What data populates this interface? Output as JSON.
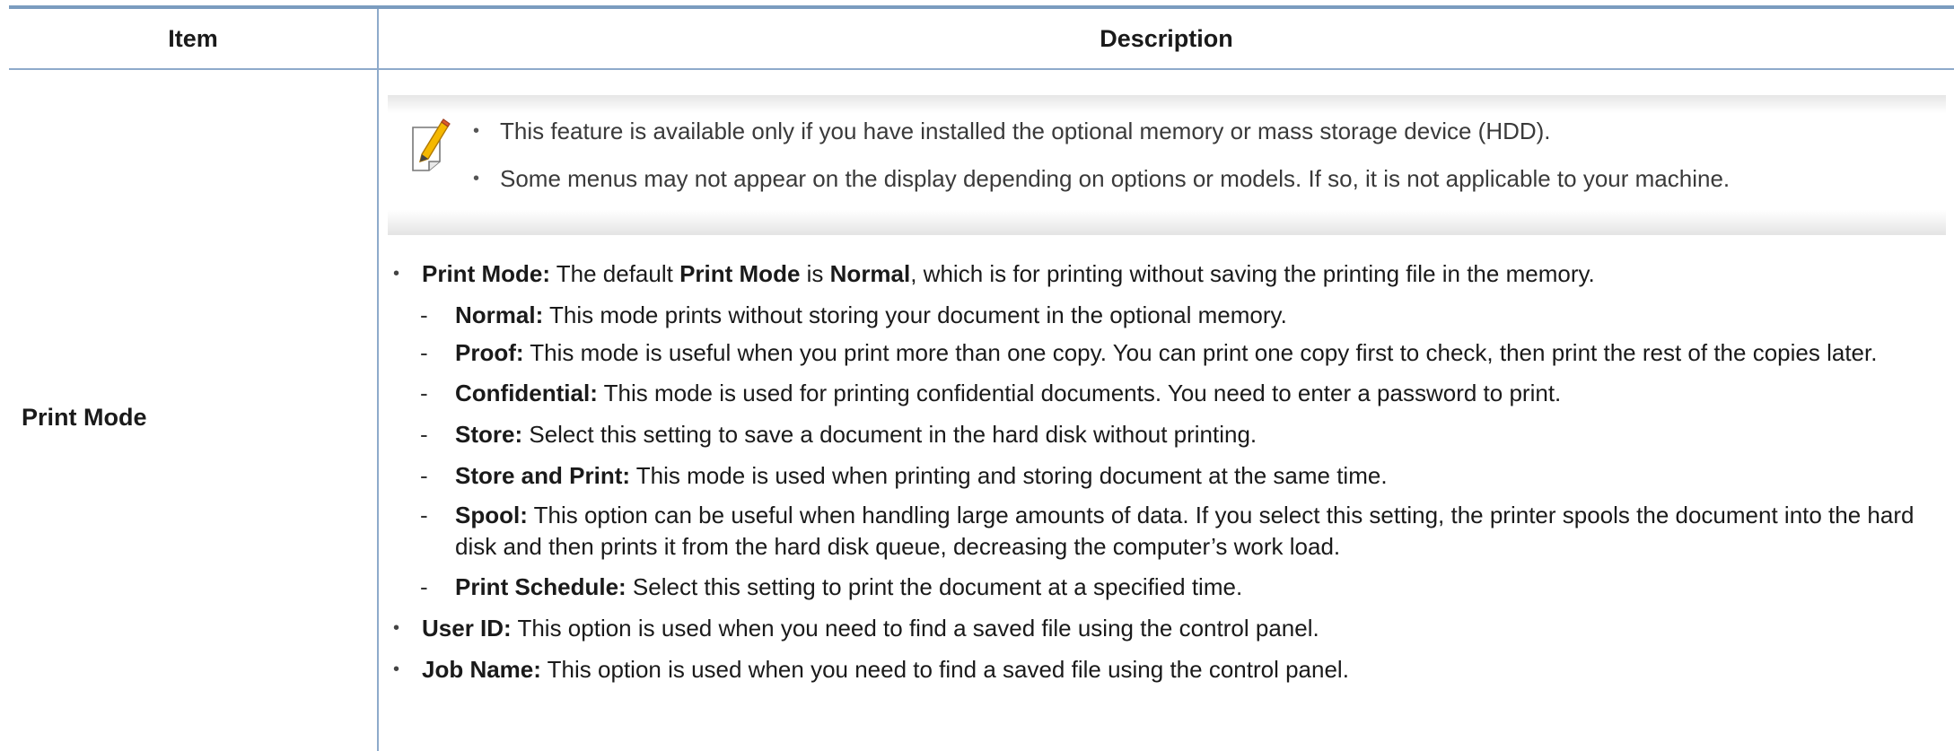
{
  "header": {
    "item": "Item",
    "description": "Description"
  },
  "row": {
    "item_label": "Print Mode",
    "notes": [
      "This feature is available only if you have installed the optional memory or mass storage device (HDD).",
      "Some menus may not appear on the display depending on options or models. If so, it is not applicable to your machine."
    ],
    "print_mode": {
      "term": "Print Mode:",
      "text1": " The default ",
      "bold1": "Print Mode",
      "text2": " is ",
      "bold2": "Normal",
      "text3": ", which is for printing without saving the printing file in the memory."
    },
    "modes": [
      {
        "term": "Normal:",
        "text": " This mode prints without storing your document in the optional memory."
      },
      {
        "term": "Proof:",
        "text": " This mode is useful when you print more than one copy. You can print one copy first to check, then print the rest of the copies later."
      },
      {
        "term": "Confidential:",
        "text": " This mode is used for printing confidential documents. You need to enter a password to print."
      },
      {
        "term": "Store:",
        "text": " Select this setting to save a document in the hard disk without printing."
      },
      {
        "term": "Store and Print:",
        "text": " This mode is used when printing and storing document at the same time."
      },
      {
        "term": "Spool:",
        "text": " This option can be useful when handling large amounts of data. If you select this setting, the printer spools the document into the hard disk and then prints it from the hard disk queue, decreasing the computer’s work load."
      },
      {
        "term": "Print Schedule:",
        "text": " Select this setting to print the document at a specified time."
      }
    ],
    "user_id": {
      "term": "User ID:",
      "text": " This option is used when you need to find a saved file using the control panel."
    },
    "job_name": {
      "term": "Job Name:",
      "text": " This option is used when you need to find a saved file using the control panel."
    }
  },
  "icons": {
    "note": "note-pencil-icon"
  }
}
